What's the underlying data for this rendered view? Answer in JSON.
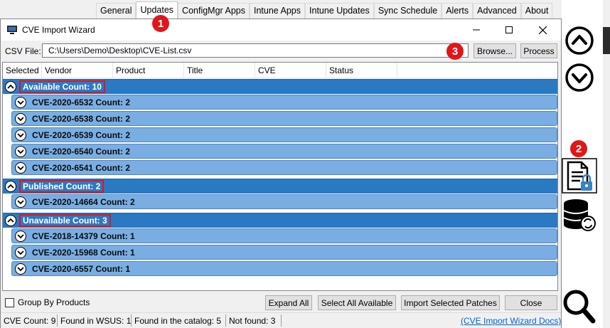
{
  "tabs": [
    "General",
    "Updates",
    "ConfigMgr Apps",
    "Intune Apps",
    "Intune Updates",
    "Sync Schedule",
    "Alerts",
    "Advanced",
    "About"
  ],
  "active_tab": "Updates",
  "dialog": {
    "title": "CVE Import Wizard",
    "window_buttons": {
      "minimize": "—",
      "maximize": "☐",
      "close": "✕"
    }
  },
  "csv": {
    "label": "CSV File:",
    "path": "C:\\Users\\Demo\\Desktop\\CVE-List.csv",
    "browse_label": "Browse...",
    "process_label": "Process"
  },
  "grid": {
    "columns": [
      "Selected",
      "Vendor",
      "Product",
      "Title",
      "CVE",
      "Status"
    ],
    "groups": [
      {
        "label": "Available Count: 10",
        "items": [
          "CVE-2020-6532 Count: 2",
          "CVE-2020-6538 Count: 2",
          "CVE-2020-6539 Count: 2",
          "CVE-2020-6540 Count: 2",
          "CVE-2020-6541 Count: 2"
        ]
      },
      {
        "label": "Published Count: 2",
        "items": [
          "CVE-2020-14664 Count: 2"
        ]
      },
      {
        "label": "Unavailable Count: 3",
        "items": [
          "CVE-2018-14379 Count: 1",
          "CVE-2020-15968 Count: 1",
          "CVE-2020-6557 Count: 1"
        ]
      }
    ]
  },
  "bottom": {
    "group_by_label": "Group By Products",
    "group_by_checked": false,
    "expand_all_label": "Expand All",
    "select_all_label": "Select All Available",
    "import_label": "Import Selected Patches",
    "close_label": "Close"
  },
  "status": {
    "cve_count": "CVE Count: 9",
    "found_wsus": "Found in WSUS: 1",
    "found_catalog": "Found in the catalog: 5",
    "not_found": "Not found: 3",
    "docs_link": "(CVE Import Wizard Docs)"
  },
  "markers": [
    "1",
    "2",
    "3"
  ],
  "colors": {
    "group_header": "#2b79c3",
    "item_row": "#7aaee2",
    "marker": "#e0161a",
    "link": "#0066cc"
  },
  "sidebar_icons": [
    "chevron-up-circle-icon",
    "chevron-down-circle-icon",
    "document-lock-icon",
    "database-sync-icon",
    "search-icon"
  ]
}
